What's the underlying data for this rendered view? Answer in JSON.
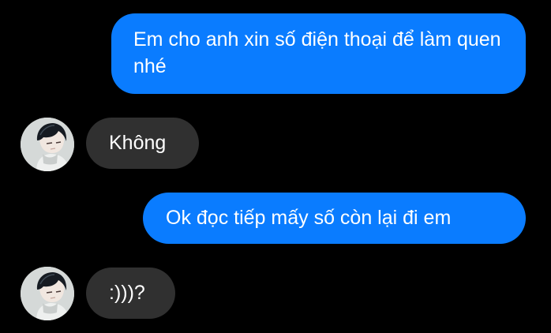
{
  "messages": [
    {
      "direction": "sent",
      "text": "Em cho anh xin số điện thoại để làm quen nhé"
    },
    {
      "direction": "received",
      "text": "Không"
    },
    {
      "direction": "sent",
      "text": "Ok đọc tiếp mấy số còn lại đi em"
    },
    {
      "direction": "received",
      "text": ":)))?"
    }
  ],
  "colors": {
    "background": "#000000",
    "sent_bubble": "#0a7cff",
    "received_bubble": "#303030",
    "text": "#ffffff"
  },
  "icons": {
    "avatar": "anime-boy-avatar-icon"
  }
}
